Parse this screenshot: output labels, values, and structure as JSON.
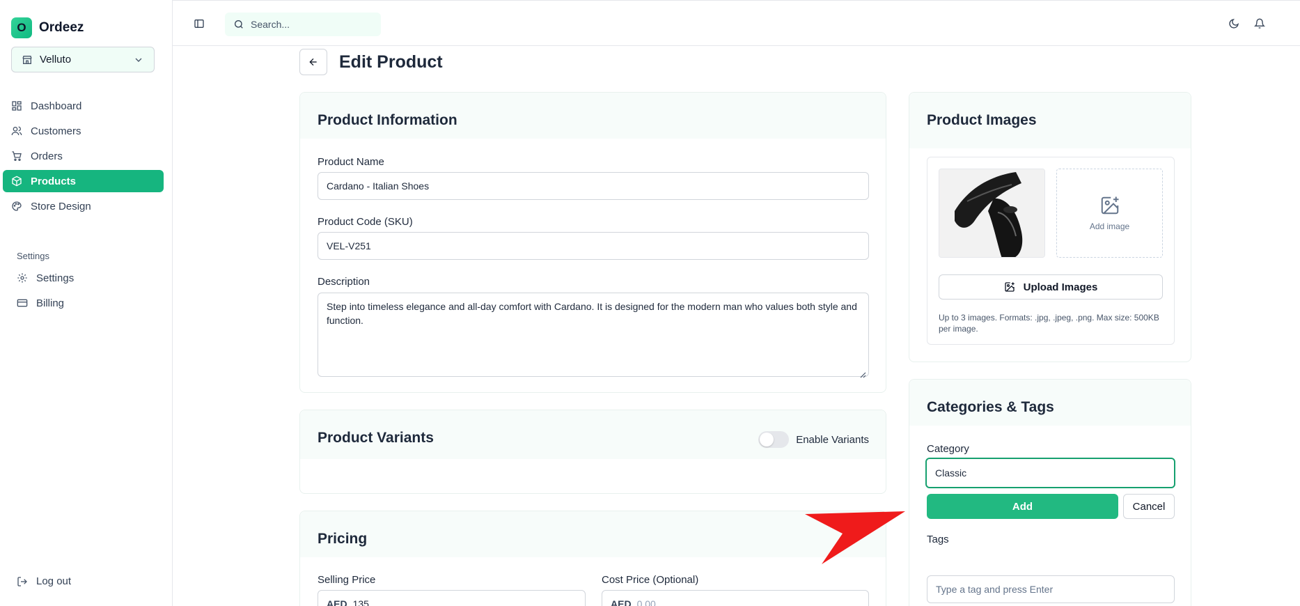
{
  "app": {
    "logo_letter": "O",
    "name": "Ordeez"
  },
  "store_selector": {
    "value": "Velluto"
  },
  "nav": {
    "items": [
      {
        "label": "Dashboard",
        "icon": "dashboard-icon"
      },
      {
        "label": "Customers",
        "icon": "users-icon"
      },
      {
        "label": "Orders",
        "icon": "cart-icon"
      },
      {
        "label": "Products",
        "icon": "box-icon",
        "active": true
      },
      {
        "label": "Store Design",
        "icon": "palette-icon"
      }
    ],
    "section_label": "Settings",
    "settings_items": [
      {
        "label": "Settings",
        "icon": "gear-icon"
      },
      {
        "label": "Billing",
        "icon": "credit-card-icon"
      }
    ],
    "logout_label": "Log out"
  },
  "topbar": {
    "search_placeholder": "Search..."
  },
  "page": {
    "title": "Edit Product"
  },
  "product_info": {
    "title": "Product Information",
    "name_label": "Product Name",
    "name_value": "Cardano - Italian Shoes",
    "sku_label": "Product Code (SKU)",
    "sku_value": "VEL-V251",
    "description_label": "Description",
    "description_value": "Step into timeless elegance and all-day comfort with Cardano. It is designed for the modern man who values both style and function."
  },
  "variants": {
    "title": "Product Variants",
    "toggle_label": "Enable Variants",
    "enabled": false
  },
  "pricing": {
    "title": "Pricing",
    "selling_label": "Selling Price",
    "currency": "AED",
    "selling_value": "135",
    "cost_label": "Cost Price (Optional)",
    "cost_placeholder": "0.00"
  },
  "images": {
    "title": "Product Images",
    "add_image_label": "Add image",
    "upload_button": "Upload Images",
    "help_text": "Up to 3 images. Formats: .jpg, .jpeg, .png. Max size: 500KB per image."
  },
  "categories": {
    "title": "Categories & Tags",
    "category_label": "Category",
    "category_value": "Classic",
    "add_button": "Add",
    "cancel_button": "Cancel",
    "tags_label": "Tags",
    "tags_placeholder": "Type a tag and press Enter"
  },
  "colors": {
    "accent": "#22b981",
    "annotation_arrow": "#ef1b1b"
  }
}
